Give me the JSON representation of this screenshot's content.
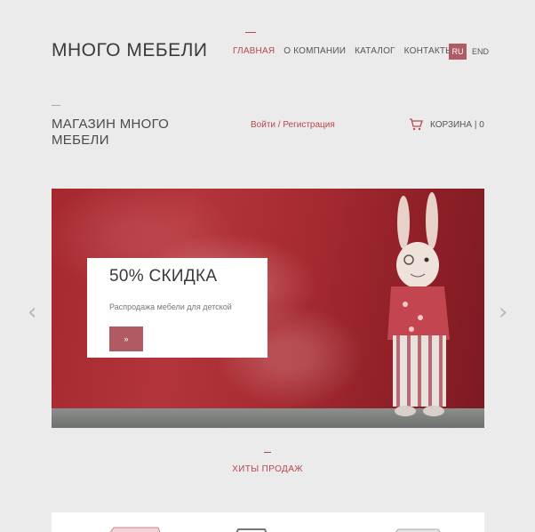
{
  "header": {
    "logo": "МНОГО МЕБЕЛИ",
    "nav": [
      {
        "label": "ГЛАВНАЯ",
        "active": true
      },
      {
        "label": "О КОМПАНИИ",
        "active": false
      },
      {
        "label": "КАТАЛОГ",
        "active": false
      },
      {
        "label": "КОНТАКТЫ",
        "active": false
      }
    ],
    "lang": {
      "ru": "RU",
      "en": "END"
    }
  },
  "subheader": {
    "store_title": "МАГАЗИН МНОГО МЕБЕЛИ",
    "auth": "Войти / Регистрация",
    "cart": "КОРЗИНА | 0"
  },
  "slider": {
    "promo_title": "50% СКИДКА",
    "promo_sub": "Распродажа мебели для детской",
    "button": "»",
    "prev": "‹",
    "next": "›"
  },
  "hits": {
    "title": "ХИТЫ ПРОДАЖ"
  },
  "colors": {
    "accent": "#b5484f",
    "button": "#b05a63",
    "background": "#ebebeb"
  }
}
